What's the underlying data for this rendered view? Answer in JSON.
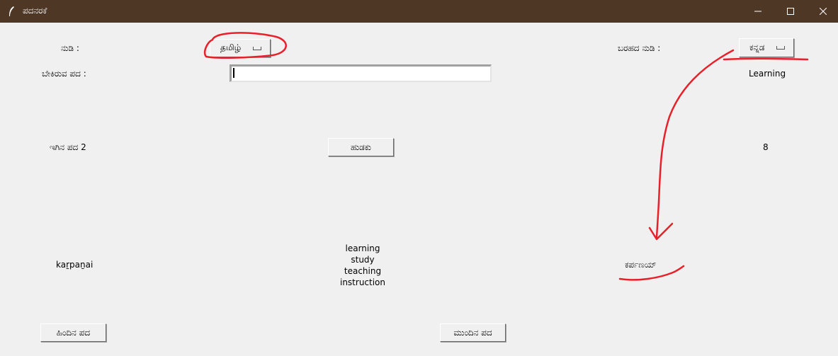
{
  "window": {
    "title": "ಪದನರಕೆ",
    "icon": "feather-icon",
    "controls": [
      "minimize-icon",
      "maximize-icon",
      "close-icon"
    ]
  },
  "form": {
    "language_label": "ನುಡಿ :",
    "language_value": "தமிழ்",
    "script_label": "ಬರಹದ ನುಡಿ :",
    "script_value": "ಕನ್ನಡ",
    "search_label": "ಬೇಕಿರುವ ಪದ :",
    "search_value": "",
    "search_placeholder": "",
    "english_word": "Learning",
    "current_word_label": "ಇಗಿನ ಪದ 2",
    "search_button": "ಹುಡಕು",
    "count": "8",
    "transliteration": "kaṟpaṉai",
    "meanings": [
      "learning",
      "study",
      "teaching",
      "instruction"
    ],
    "kannada_script_word": "ಕರ್ಪಣಯ್",
    "prev_button": "ಹಿಂದಿನ ಪದ",
    "next_button": "ಮುಂದಿನ ಪದ"
  },
  "colors": {
    "titlebar": "#4f3726",
    "background": "#f0f0f0",
    "annotation": "#e8202a"
  }
}
